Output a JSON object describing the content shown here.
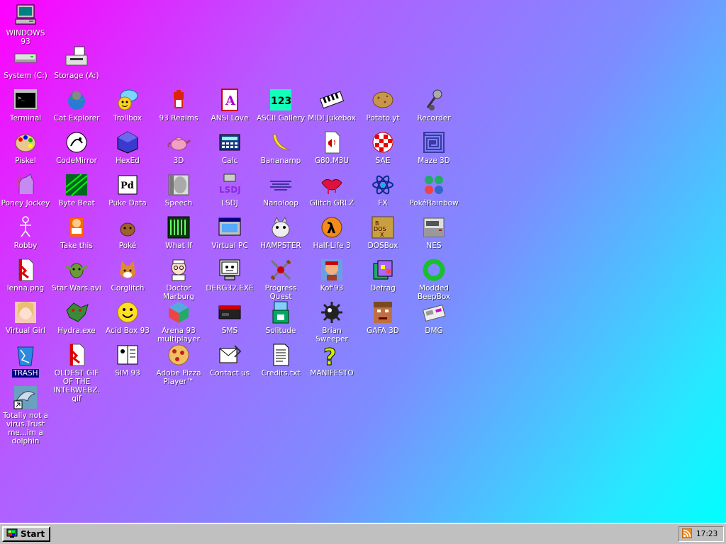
{
  "desktop": {
    "icons": [
      {
        "label": "WINDOWS 93",
        "icon": "computer-icon",
        "col": 0,
        "row": 0
      },
      {
        "label": "System (C:)",
        "icon": "drive-icon",
        "col": 0,
        "row": 1
      },
      {
        "label": "Storage (A:)",
        "icon": "floppy-drive-icon",
        "col": 1,
        "row": 1
      },
      {
        "label": "Terminal",
        "icon": "terminal-icon",
        "col": 0,
        "row": 2
      },
      {
        "label": "Cat Explorer",
        "icon": "cat-globe-icon",
        "col": 1,
        "row": 2
      },
      {
        "label": "Trollbox",
        "icon": "chat-bubble-icon",
        "col": 2,
        "row": 2
      },
      {
        "label": "93 Realms",
        "icon": "knight-icon",
        "col": 3,
        "row": 2
      },
      {
        "label": "ANSI Love",
        "icon": "ansi-letter-icon",
        "col": 4,
        "row": 2
      },
      {
        "label": "ASCII Gallery",
        "icon": "ascii-123-icon",
        "col": 5,
        "row": 2
      },
      {
        "label": "MIDI Jukebox",
        "icon": "piano-keys-icon",
        "col": 6,
        "row": 2
      },
      {
        "label": "Potato.yt",
        "icon": "potato-icon",
        "col": 7,
        "row": 2
      },
      {
        "label": "Recorder",
        "icon": "microphone-icon",
        "col": 8,
        "row": 2
      },
      {
        "label": "Piskel",
        "icon": "palette-icon",
        "col": 0,
        "row": 3
      },
      {
        "label": "CodeMirror",
        "icon": "code-mirror-icon",
        "col": 1,
        "row": 3
      },
      {
        "label": "HexEd",
        "icon": "hex-cube-icon",
        "col": 2,
        "row": 3
      },
      {
        "label": "3D",
        "icon": "teapot-icon",
        "col": 3,
        "row": 3
      },
      {
        "label": "Calc",
        "icon": "calculator-icon",
        "col": 4,
        "row": 3
      },
      {
        "label": "Bananamp",
        "icon": "banana-icon",
        "col": 5,
        "row": 3
      },
      {
        "label": "G80.M3U",
        "icon": "playlist-file-icon",
        "col": 6,
        "row": 3
      },
      {
        "label": "SAE",
        "icon": "amiga-ball-icon",
        "col": 7,
        "row": 3
      },
      {
        "label": "Maze 3D",
        "icon": "maze-icon",
        "col": 8,
        "row": 3
      },
      {
        "label": "Poney Jockey",
        "icon": "pony-icon",
        "col": 0,
        "row": 4
      },
      {
        "label": "Byte Beat",
        "icon": "byte-beat-icon",
        "col": 1,
        "row": 4
      },
      {
        "label": "Puke Data",
        "icon": "pd-icon",
        "col": 2,
        "row": 4
      },
      {
        "label": "Speech",
        "icon": "speech-face-icon",
        "col": 3,
        "row": 4
      },
      {
        "label": "LSDJ",
        "icon": "lsdj-icon",
        "col": 4,
        "row": 4
      },
      {
        "label": "Nanoloop",
        "icon": "nanoloop-icon",
        "col": 5,
        "row": 4
      },
      {
        "label": "Glitch GRLZ",
        "icon": "lips-icon",
        "col": 6,
        "row": 4
      },
      {
        "label": "FX",
        "icon": "atom-icon",
        "col": 7,
        "row": 4
      },
      {
        "label": "PokéRainbow",
        "icon": "trainers-icon",
        "col": 8,
        "row": 4
      },
      {
        "label": "Robby",
        "icon": "stick-figure-icon",
        "col": 0,
        "row": 5
      },
      {
        "label": "Take this",
        "icon": "take-this-icon",
        "col": 1,
        "row": 5
      },
      {
        "label": "Poké ",
        "icon": "pokemon-icon",
        "col": 2,
        "row": 5
      },
      {
        "label": "What If",
        "icon": "what-if-icon",
        "col": 3,
        "row": 5
      },
      {
        "label": "Virtual PC",
        "icon": "virtual-pc-icon",
        "col": 4,
        "row": 5
      },
      {
        "label": "HAMPSTER",
        "icon": "hamster-icon",
        "col": 5,
        "row": 5
      },
      {
        "label": "Half-Life 3",
        "icon": "lambda-icon",
        "col": 6,
        "row": 5
      },
      {
        "label": "DOSBox",
        "icon": "dosbox-icon",
        "col": 7,
        "row": 5
      },
      {
        "label": "NES",
        "icon": "nes-console-icon",
        "col": 8,
        "row": 5
      },
      {
        "label": "lenna.png",
        "icon": "image-file-icon",
        "col": 0,
        "row": 6
      },
      {
        "label": "Star Wars.avi",
        "icon": "yoda-icon",
        "col": 1,
        "row": 6
      },
      {
        "label": "Corglitch",
        "icon": "corgi-icon",
        "col": 2,
        "row": 6
      },
      {
        "label": "Doctor Marburg",
        "icon": "doctor-icon",
        "col": 3,
        "row": 6
      },
      {
        "label": "DERG32.EXE",
        "icon": "derg-monitor-icon",
        "col": 4,
        "row": 6
      },
      {
        "label": "Progress Quest",
        "icon": "crossed-swords-icon",
        "col": 5,
        "row": 6
      },
      {
        "label": "Kof'93",
        "icon": "fighter-icon",
        "col": 6,
        "row": 6
      },
      {
        "label": "Defrag",
        "icon": "defrag-icon",
        "col": 7,
        "row": 6
      },
      {
        "label": "Modded BeepBox",
        "icon": "green-ring-icon",
        "col": 8,
        "row": 6
      },
      {
        "label": "Virtual Girl",
        "icon": "virtual-girl-icon",
        "col": 0,
        "row": 7
      },
      {
        "label": "Hydra.exe",
        "icon": "hydra-icon",
        "col": 1,
        "row": 7
      },
      {
        "label": "Acid Box 93",
        "icon": "smiley-icon",
        "col": 2,
        "row": 7
      },
      {
        "label": "Arena 93 multiplayer",
        "icon": "arena-cube-icon",
        "col": 3,
        "row": 7
      },
      {
        "label": "SMS",
        "icon": "sms-console-icon",
        "col": 4,
        "row": 7
      },
      {
        "label": "Solitude",
        "icon": "solitude-icon",
        "col": 5,
        "row": 7
      },
      {
        "label": "Brian Sweeper",
        "icon": "mine-icon",
        "col": 6,
        "row": 7
      },
      {
        "label": "GAFA 3D",
        "icon": "doom-face-icon",
        "col": 7,
        "row": 7
      },
      {
        "label": "DMG",
        "icon": "dmg-icon",
        "col": 8,
        "row": 7
      },
      {
        "label": "TRASH",
        "icon": "trash-icon",
        "col": 0,
        "row": 8,
        "selected": true
      },
      {
        "label": "OLDEST GIF OF THE INTERWEBZ.gif",
        "icon": "gif-file-icon",
        "col": 1,
        "row": 8
      },
      {
        "label": "SIM 93",
        "icon": "sim-book-icon",
        "col": 2,
        "row": 8
      },
      {
        "label": "Adobe Pizza Player™",
        "icon": "pizza-icon",
        "col": 3,
        "row": 8
      },
      {
        "label": "Contact us",
        "icon": "contact-note-icon",
        "col": 4,
        "row": 8
      },
      {
        "label": "Credits.txt",
        "icon": "text-file-icon",
        "col": 5,
        "row": 8
      },
      {
        "label": "MANIFESTO",
        "icon": "question-mark-icon",
        "col": 6,
        "row": 8
      },
      {
        "label": "Totally not a virus.Trust me...im a dolphin",
        "icon": "dolphin-shortcut-icon",
        "col": 0,
        "row": 9
      }
    ]
  },
  "taskbar": {
    "start_label": "Start",
    "clock": "17:23"
  }
}
